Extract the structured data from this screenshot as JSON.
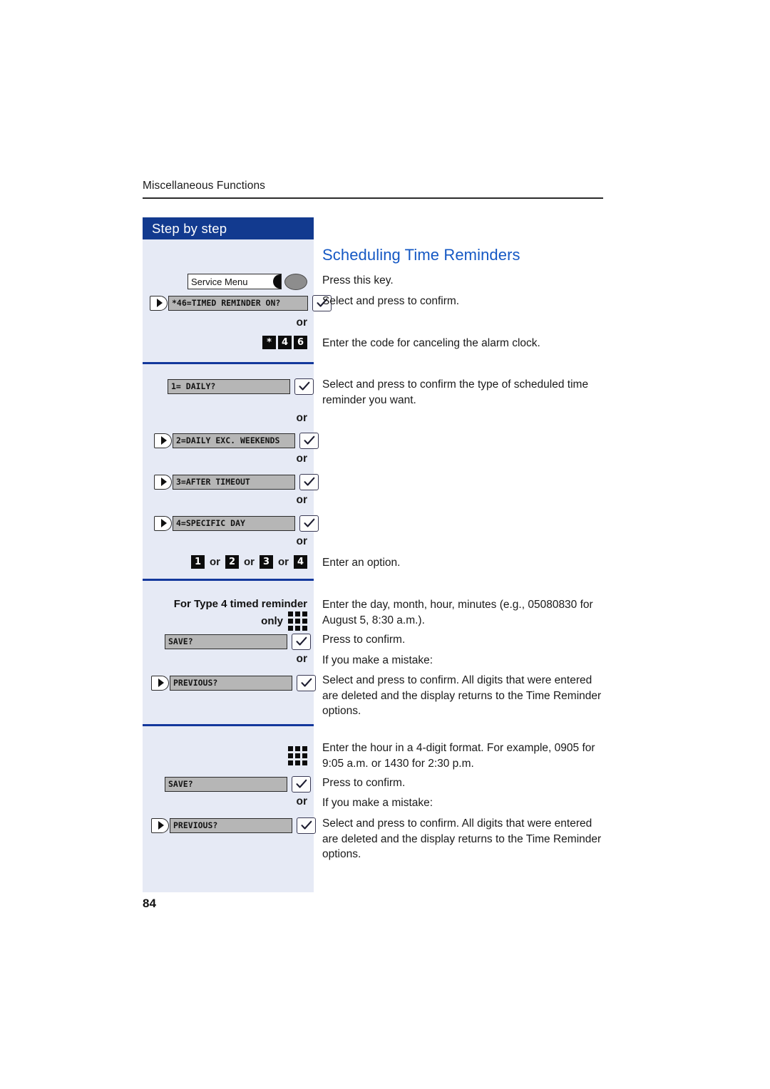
{
  "page": {
    "running_head": "Miscellaneous Functions",
    "folio": "84",
    "accent_blue": "#123a8f",
    "heading_blue": "#1558c4",
    "sidebar_bg": "#e6eaf5"
  },
  "sidebar": {
    "title": "Step by step",
    "service_key": {
      "label": "Service Menu",
      "icon": "service-menu-key-icon"
    },
    "or_label": "or",
    "section1": {
      "lcd_timed_reminder": "*46=TIMED REMINDER ON?",
      "code_keys": [
        "*",
        "4",
        "6"
      ]
    },
    "section2": {
      "lcd_daily": "1= DAILY?",
      "lcd_daily_exc_weekends": "2=DAILY EXC. WEEKENDS",
      "lcd_after_timeout": "3=AFTER TIMEOUT",
      "lcd_specific_day": "4=SPECIFIC DAY",
      "option_keys": [
        "1",
        "2",
        "3",
        "4"
      ]
    },
    "section3": {
      "note_line1": "For Type 4 timed reminder",
      "note_line2": "only",
      "keypad_icon": "keypad-icon",
      "lcd_save": "SAVE?",
      "lcd_previous": "PREVIOUS?"
    },
    "section4": {
      "keypad_icon": "keypad-icon",
      "lcd_save": "SAVE?",
      "lcd_previous": "PREVIOUS?"
    }
  },
  "main": {
    "heading": "Scheduling Time Reminders",
    "p_press_this_key": "Press this key.",
    "p_select_confirm": "Select and press to confirm.",
    "p_enter_cancel_code": "Enter the code for canceling the alarm clock.",
    "p_select_confirm_type": "Select and press to confirm the type of scheduled time reminder you want.",
    "p_enter_an_option": "Enter an option.",
    "p_enter_day_month": "Enter the day, month, hour, minutes (e.g., 05080830 for August 5, 8:30 a.m.).",
    "p_press_to_confirm_1": "Press to confirm.",
    "p_if_mistake_1": "If you make a mistake:",
    "p_delete_digits_1": "Select and press to confirm. All digits that were entered are deleted and the display returns to the Time Reminder options.",
    "p_enter_hour": "Enter the hour in a 4-digit format. For example, 0905 for 9:05 a.m. or 1430 for 2:30 p.m.",
    "p_press_to_confirm_2": "Press to confirm.",
    "p_if_mistake_2": "If you make a mistake:",
    "p_delete_digits_2": "Select and press to confirm. All digits that were entered are deleted and the display returns to the Time Reminder options."
  }
}
